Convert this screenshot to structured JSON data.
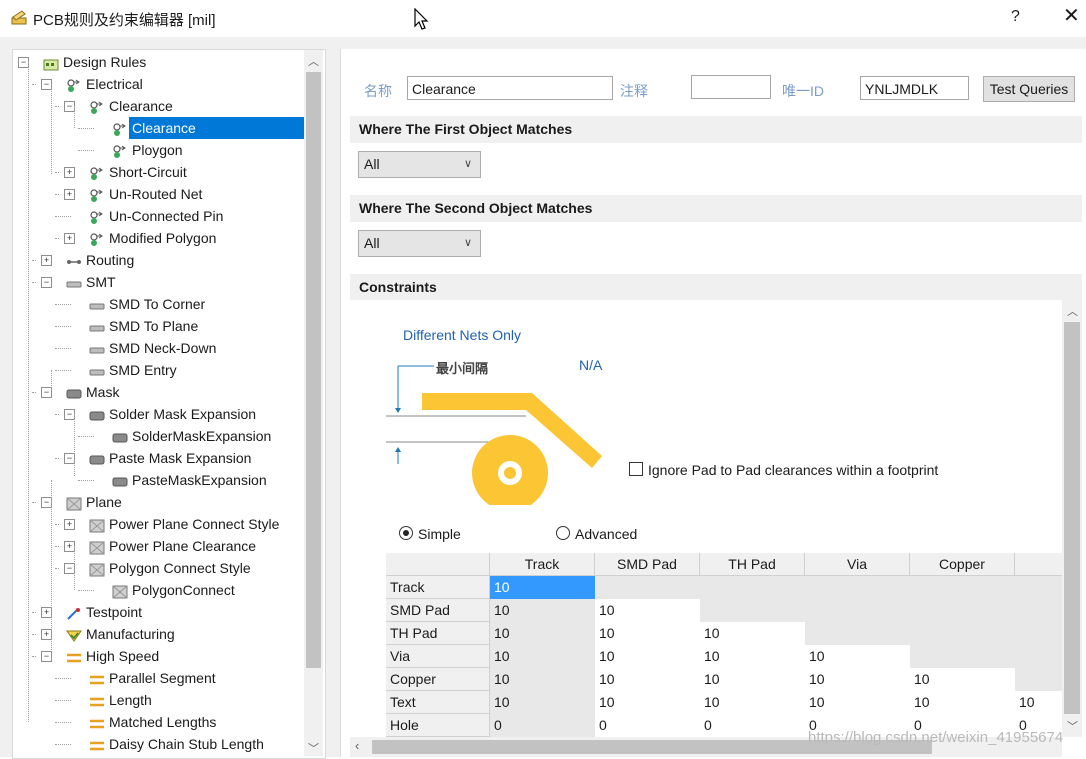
{
  "window": {
    "title": "PCB规则及约束编辑器 [mil]",
    "help": "?",
    "close": "✕"
  },
  "tree": {
    "items": [
      {
        "label": "Design Rules"
      },
      {
        "label": "Electrical"
      },
      {
        "label": "Clearance"
      },
      {
        "label": "Clearance"
      },
      {
        "label": "Ploygon"
      },
      {
        "label": "Short-Circuit"
      },
      {
        "label": "Un-Routed Net"
      },
      {
        "label": "Un-Connected Pin"
      },
      {
        "label": "Modified Polygon"
      },
      {
        "label": "Routing"
      },
      {
        "label": "SMT"
      },
      {
        "label": "SMD To Corner"
      },
      {
        "label": "SMD To Plane"
      },
      {
        "label": "SMD Neck-Down"
      },
      {
        "label": "SMD Entry"
      },
      {
        "label": "Mask"
      },
      {
        "label": "Solder Mask Expansion"
      },
      {
        "label": "SolderMaskExpansion"
      },
      {
        "label": "Paste Mask Expansion"
      },
      {
        "label": "PasteMaskExpansion"
      },
      {
        "label": "Plane"
      },
      {
        "label": "Power Plane Connect Style"
      },
      {
        "label": "Power Plane Clearance"
      },
      {
        "label": "Polygon Connect Style"
      },
      {
        "label": "PolygonConnect"
      },
      {
        "label": "Testpoint"
      },
      {
        "label": "Manufacturing"
      },
      {
        "label": "High Speed"
      },
      {
        "label": "Parallel Segment"
      },
      {
        "label": "Length"
      },
      {
        "label": "Matched Lengths"
      },
      {
        "label": "Daisy Chain Stub Length"
      }
    ]
  },
  "rule": {
    "name_label": "名称",
    "name_value": "Clearance",
    "comment_label": "注释",
    "comment_value": "",
    "uid_label": "唯一ID",
    "uid_value": "YNLJMDLK",
    "test_button": "Test Queries"
  },
  "first_match": {
    "heading": "Where The First Object Matches",
    "value": "All"
  },
  "second_match": {
    "heading": "Where The Second Object Matches",
    "value": "All"
  },
  "constraints": {
    "heading": "Constraints",
    "nets_label": "Different Nets Only",
    "min_label": "最小间隔",
    "min_value": "N/A",
    "ignore_pad": "Ignore Pad to Pad clearances within a footprint",
    "mode_simple": "Simple",
    "mode_advanced": "Advanced"
  },
  "grid": {
    "columns": [
      "Track",
      "SMD Pad",
      "TH Pad",
      "Via",
      "Copper",
      "T"
    ],
    "rows": [
      {
        "label": "Track",
        "values": [
          "10"
        ]
      },
      {
        "label": "SMD Pad",
        "values": [
          "10",
          "10"
        ]
      },
      {
        "label": "TH Pad",
        "values": [
          "10",
          "10",
          "10"
        ]
      },
      {
        "label": "Via",
        "values": [
          "10",
          "10",
          "10",
          "10"
        ]
      },
      {
        "label": "Copper",
        "values": [
          "10",
          "10",
          "10",
          "10",
          "10"
        ]
      },
      {
        "label": "Text",
        "values": [
          "10",
          "10",
          "10",
          "10",
          "10",
          "10"
        ]
      },
      {
        "label": "Hole",
        "values": [
          "0",
          "0",
          "0",
          "0",
          "0",
          "0"
        ]
      }
    ]
  },
  "watermark": "https://blog.csdn.net/weixin_41955674",
  "colors": {
    "accent": "#0078d7",
    "shape": "#fbc534",
    "link": "#1f62b5"
  }
}
